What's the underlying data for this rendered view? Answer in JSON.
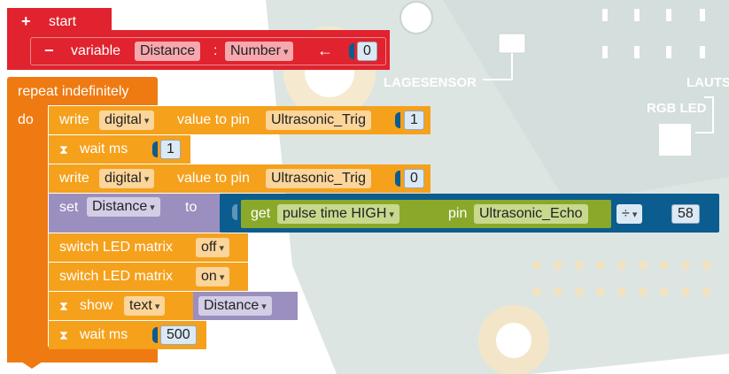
{
  "start": {
    "plus": "+",
    "label": "start"
  },
  "variable": {
    "minus": "−",
    "label": "variable",
    "name": "Distance",
    "colon": ":",
    "type": "Number",
    "arrow": "←",
    "value": "0"
  },
  "repeat": {
    "label": "repeat indefinitely",
    "do": "do"
  },
  "write1": {
    "label": "write",
    "mode": "digital",
    "mid": "value to pin",
    "pin": "Ultrasonic_Trig",
    "value": "1"
  },
  "wait1": {
    "icon": "⧗",
    "label": "wait ms",
    "value": "1"
  },
  "write2": {
    "label": "write",
    "mode": "digital",
    "mid": "value to pin",
    "pin": "Ultrasonic_Trig",
    "value": "0"
  },
  "set": {
    "label": "set",
    "var": "Distance",
    "to": "to",
    "get": {
      "label": "get",
      "mode": "pulse time HIGH",
      "pin_label": "pin",
      "pin": "Ultrasonic_Echo"
    },
    "op": "÷",
    "divisor": "58"
  },
  "led_off": {
    "label": "switch LED matrix",
    "value": "off"
  },
  "led_on": {
    "label": "switch LED matrix",
    "value": "on"
  },
  "show": {
    "icon": "⧗",
    "label": "show",
    "mode": "text",
    "var": "Distance"
  },
  "wait2": {
    "icon": "⧗",
    "label": "wait ms",
    "value": "500"
  },
  "board": {
    "lagesensor": "LAGESENSOR",
    "rgbled": "RGB LED",
    "lauts": "LAUTS"
  },
  "colors": {
    "event": "#e0232e",
    "loop": "#ef7a12",
    "io": "#f5a11c",
    "logic_var": "#9b8fbf",
    "math": "#0b5c8f",
    "sensor": "#8aa92a"
  }
}
